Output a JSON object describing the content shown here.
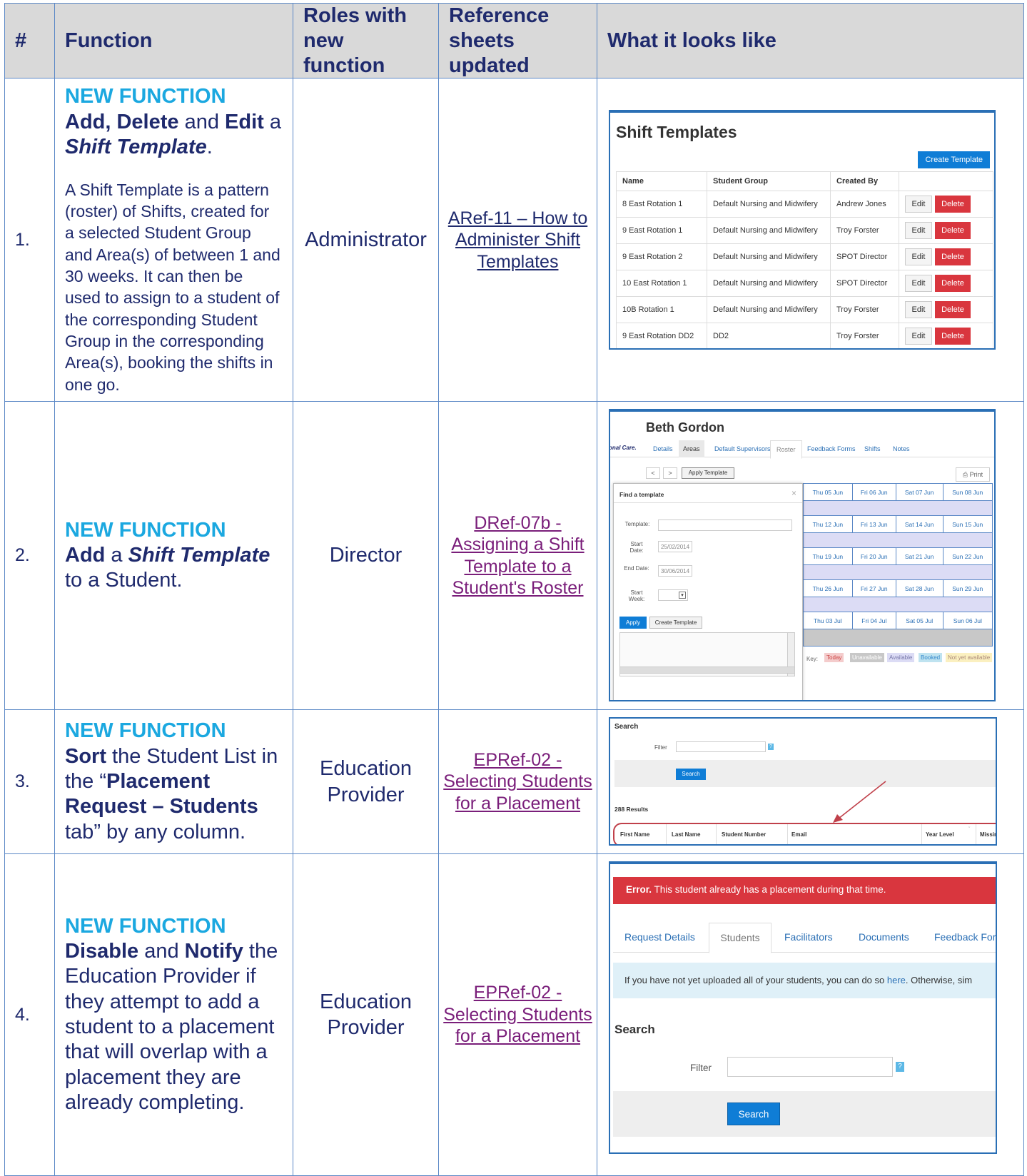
{
  "headers": {
    "num": "#",
    "function": "Function",
    "roles": "Roles with new function",
    "refs": "Reference sheets updated",
    "looks": "What it looks like"
  },
  "rows": [
    {
      "num": "1.",
      "new_label": "NEW FUNCTION",
      "desc": "A Shift Template is a pattern (roster) of Shifts, created for a selected Student Group and Area(s) of between 1 and 30 weeks. It can then be used to assign to a student of the corresponding Student Group in the corresponding Area(s), booking the shifts in one go.",
      "role": "Administrator",
      "ref": "ARef-11 – How to Administer Shift Templates"
    },
    {
      "num": "2.",
      "new_label": "NEW FUNCTION",
      "role": "Director",
      "ref": "DRef-07b - Assigning a Shift Template to a Student's Roster"
    },
    {
      "num": "3.",
      "new_label": "NEW FUNCTION",
      "role": "Education Provider",
      "ref": "EPRef-02 - Selecting Students for a Placement"
    },
    {
      "num": "4.",
      "new_label": "NEW FUNCTION",
      "role": "Education Provider",
      "ref": "EPRef-02 - Selecting Students for a Placement"
    }
  ],
  "shot1": {
    "title": "Shift Templates",
    "create_btn": "Create Template",
    "cols": [
      "Name",
      "Student Group",
      "Created By",
      ""
    ],
    "rows": [
      [
        "8 East Rotation 1",
        "Default Nursing and Midwifery",
        "Andrew Jones"
      ],
      [
        "9 East Rotation 1",
        "Default Nursing and Midwifery",
        "Troy Forster"
      ],
      [
        "9 East Rotation 2",
        "Default Nursing and Midwifery",
        "SPOT Director"
      ],
      [
        "10 East Rotation 1",
        "Default Nursing and Midwifery",
        "SPOT Director"
      ],
      [
        "10B Rotation 1",
        "Default Nursing and Midwifery",
        "Troy Forster"
      ],
      [
        "9 East Rotation DD2",
        "DD2",
        "Troy Forster"
      ]
    ],
    "edit": "Edit",
    "delete": "Delete"
  },
  "shot2": {
    "name": "Beth Gordon",
    "logo_text": "onal Care.",
    "tabs": [
      "Details",
      "Areas",
      "Default Supervisors",
      "Roster",
      "Feedback Forms",
      "Shifts",
      "Notes"
    ],
    "prev": "<",
    "next": ">",
    "apply_template": "Apply Template",
    "print": "Print",
    "popup": {
      "title": "Find a template",
      "close": "×",
      "template_label": "Template:",
      "start_label": "Start Date:",
      "start_val": "25/02/2014",
      "end_label": "End Date:",
      "end_val": "30/06/2014",
      "week_label": "Start Week:",
      "apply": "Apply",
      "create": "Create Template"
    },
    "cal": [
      [
        "Thu 05 Jun",
        "Fri 06 Jun",
        "Sat 07 Jun",
        "Sun 08 Jun"
      ],
      [
        "Thu 12 Jun",
        "Fri 13 Jun",
        "Sat 14 Jun",
        "Sun 15 Jun"
      ],
      [
        "Thu 19 Jun",
        "Fri 20 Jun",
        "Sat 21 Jun",
        "Sun 22 Jun"
      ],
      [
        "Thu 26 Jun",
        "Fri 27 Jun",
        "Sat 28 Jun",
        "Sun 29 Jun"
      ],
      [
        "Thu 03 Jul",
        "Fri 04 Jul",
        "Sat 05 Jul",
        "Sun 06 Jul"
      ]
    ],
    "key": {
      "label": "Key:",
      "today": "Today",
      "unavailable": "Unavailable",
      "available": "Available",
      "booked": "Booked",
      "notyet": "Not yet available"
    }
  },
  "shot3": {
    "title": "Search",
    "filter": "Filter",
    "help": "?",
    "search_btn": "Search",
    "results": "288 Results",
    "cols": [
      "First Name",
      "Last Name",
      "Student Number",
      "Email",
      "Year Level",
      "Missing"
    ]
  },
  "shot4": {
    "error_bold": "Error.",
    "error_text": "This student already has a placement during that time.",
    "tabs": [
      "Request Details",
      "Students",
      "Facilitators",
      "Documents",
      "Feedback For"
    ],
    "info_pre": "If you have not yet uploaded all of your students, you can do so",
    "info_link": "here",
    "info_post": ". Otherwise, sim",
    "search_title": "Search",
    "filter": "Filter",
    "help": "?",
    "search_btn": "Search"
  },
  "colors": {
    "accent": "#1ba8e0",
    "navy": "#1f2a6d",
    "border": "#5b88c6",
    "error": "#d9363e",
    "button": "#0f7dd6"
  }
}
